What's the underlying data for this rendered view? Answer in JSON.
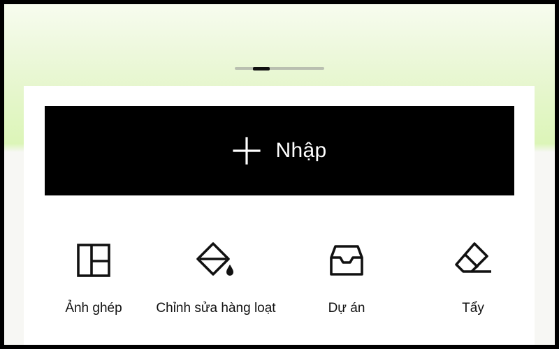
{
  "import_button": {
    "label": "Nhập",
    "icon": "plus-icon"
  },
  "pager": {
    "pages": 3,
    "active_index": 1
  },
  "tools": [
    {
      "label": "Ảnh ghép",
      "icon": "collage-icon"
    },
    {
      "label": "Chỉnh sửa hàng loạt",
      "icon": "paint-bucket-icon"
    },
    {
      "label": "Dự án",
      "icon": "inbox-tray-icon"
    },
    {
      "label": "Tẩy",
      "icon": "eraser-icon"
    }
  ],
  "colors": {
    "primary_button_bg": "#000000",
    "primary_button_text": "#ffffff",
    "top_gradient_green": "#dcf5b8",
    "panel_bg": "#ffffff",
    "text": "#111111"
  }
}
